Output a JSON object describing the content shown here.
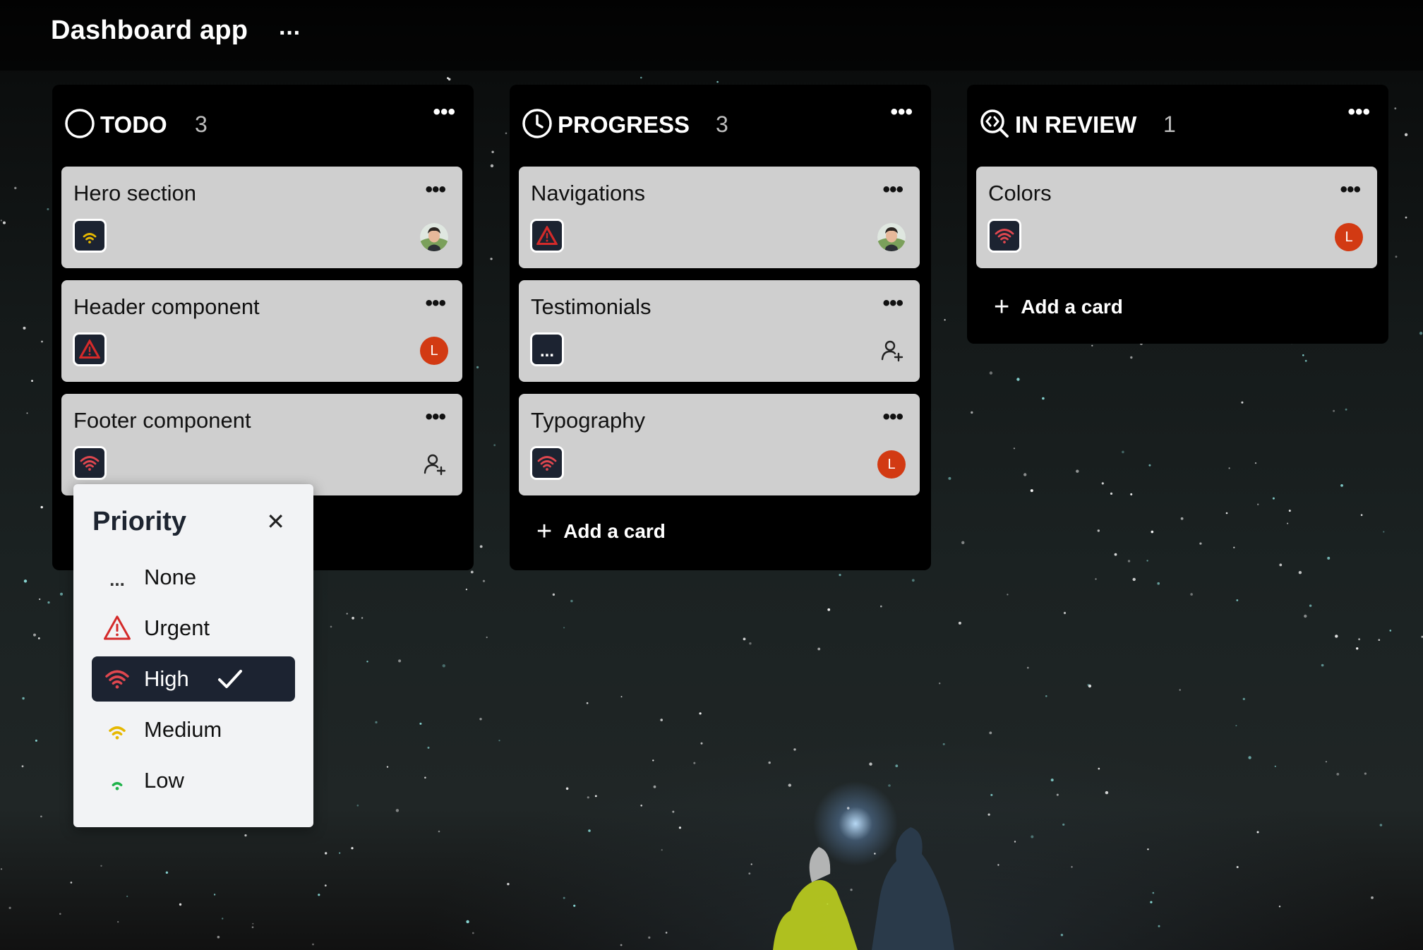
{
  "app": {
    "title": "Dashboard app",
    "more": "···"
  },
  "colors": {
    "urgent": "#d42a2a",
    "high": "#e0474f",
    "medium": "#e6b800",
    "low": "#1fb34a",
    "selected_bg": "#1c2331",
    "avatar_l": "#d23a13"
  },
  "columns": [
    {
      "title": "TODO",
      "count": "3",
      "icon": "circle-icon",
      "cards": [
        {
          "title": "Hero section",
          "priority": "medium",
          "assignee": "photo"
        },
        {
          "title": "Header component",
          "priority": "urgent",
          "assignee": "L"
        },
        {
          "title": "Footer component",
          "priority": "high",
          "assignee": "none"
        }
      ]
    },
    {
      "title": "PROGRESS",
      "count": "3",
      "icon": "clock-icon",
      "cards": [
        {
          "title": "Navigations",
          "priority": "urgent",
          "assignee": "photo"
        },
        {
          "title": "Testimonials",
          "priority": "none",
          "priority_text": "...",
          "assignee": "none"
        },
        {
          "title": "Typography",
          "priority": "high",
          "assignee": "L"
        }
      ],
      "add_card": "Add a card"
    },
    {
      "title": "IN REVIEW",
      "count": "1",
      "icon": "search-review-icon",
      "cards": [
        {
          "title": "Colors",
          "priority": "high",
          "assignee": "L"
        }
      ],
      "add_card": "Add a card"
    }
  ],
  "card_more": "•••",
  "add_plus": "+",
  "priority_menu": {
    "title": "Priority",
    "close": "✕",
    "selected": "High",
    "options": [
      {
        "label": "None",
        "icon": "...",
        "icon_name": "none-dots-icon"
      },
      {
        "label": "Urgent",
        "icon_name": "alert-triangle-icon"
      },
      {
        "label": "High",
        "icon_name": "signal-high-icon"
      },
      {
        "label": "Medium",
        "icon_name": "signal-medium-icon"
      },
      {
        "label": "Low",
        "icon_name": "signal-low-icon"
      }
    ]
  }
}
